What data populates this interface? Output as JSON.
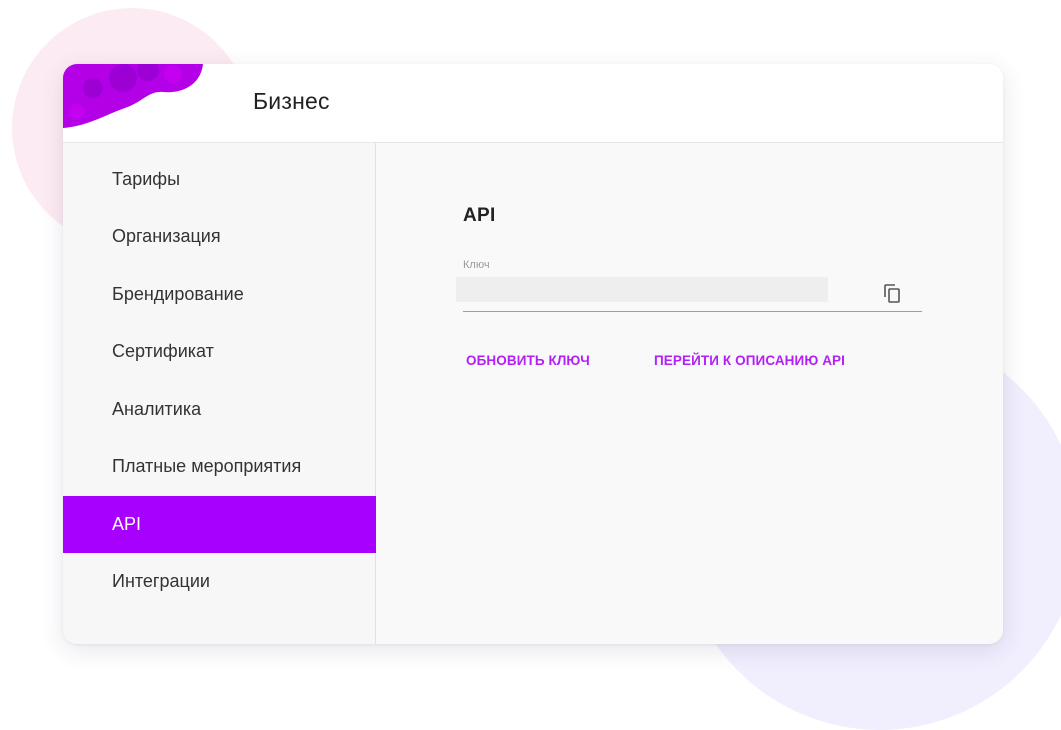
{
  "header": {
    "title": "Бизнес"
  },
  "sidebar": {
    "items": [
      {
        "label": "Тарифы"
      },
      {
        "label": "Организация"
      },
      {
        "label": "Брендирование"
      },
      {
        "label": "Сертификат"
      },
      {
        "label": "Аналитика"
      },
      {
        "label": "Платные мероприятия"
      },
      {
        "label": "API",
        "active": true
      },
      {
        "label": "Интеграции"
      }
    ]
  },
  "api_section": {
    "title": "API",
    "key_field": {
      "label": "Ключ",
      "value": ""
    },
    "copy_icon": "copy-icon",
    "actions": {
      "refresh_label": "ОБНОВИТЬ КЛЮЧ",
      "docs_label": "ПЕРЕЙТИ К ОПИСАНИЮ API"
    }
  },
  "colors": {
    "accent": "#a800ff",
    "link": "#b320f5",
    "blob": "#b400e6",
    "bg_pink": "#fdebf3",
    "bg_lilac": "#f1eefe"
  }
}
